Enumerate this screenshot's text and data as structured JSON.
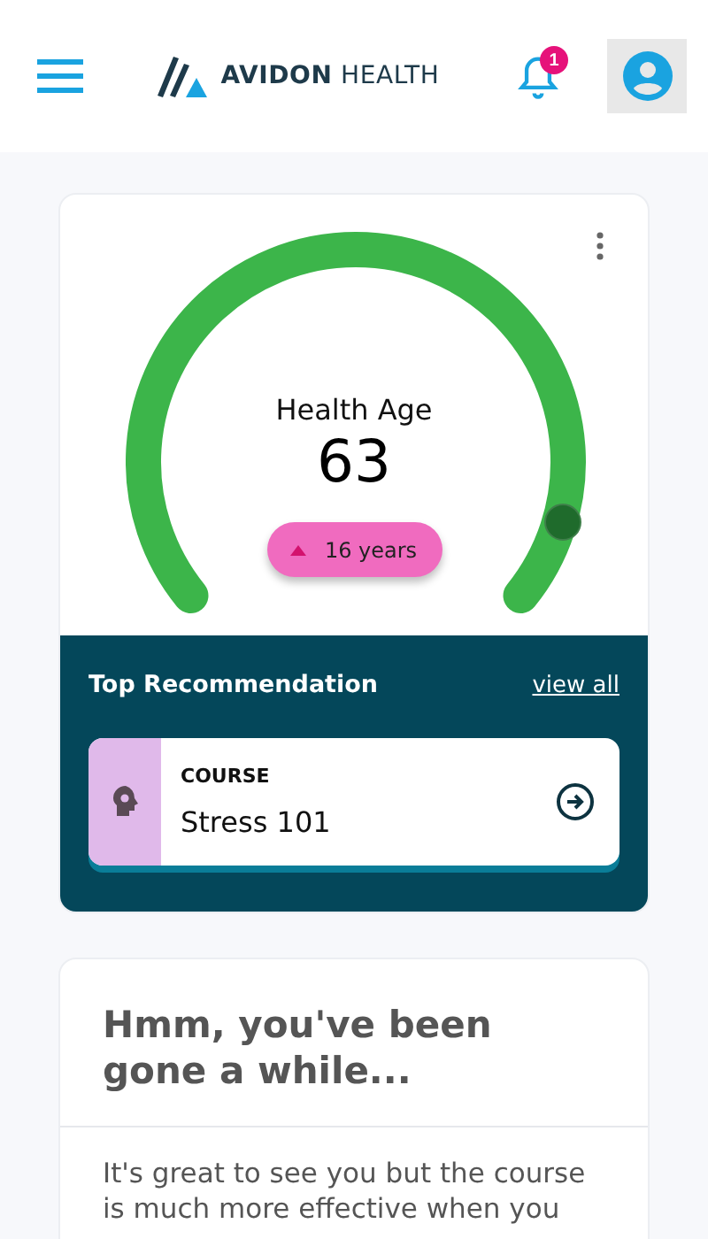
{
  "header": {
    "logo_text": "AVIDON",
    "logo_text_light": "HEALTH",
    "notification_count": "1"
  },
  "health_card": {
    "title": "Health Age",
    "value": "63",
    "change": {
      "increased": true,
      "text": "16 years"
    },
    "recommendation": {
      "title": "Top Recommendation",
      "link": "view all",
      "item": {
        "category": "COURSE",
        "name": "Stress 101"
      }
    }
  },
  "message_card": {
    "title": "Hmm, you've been gone a while...",
    "body": "It's great to see you but the course is much more effective when you"
  }
}
